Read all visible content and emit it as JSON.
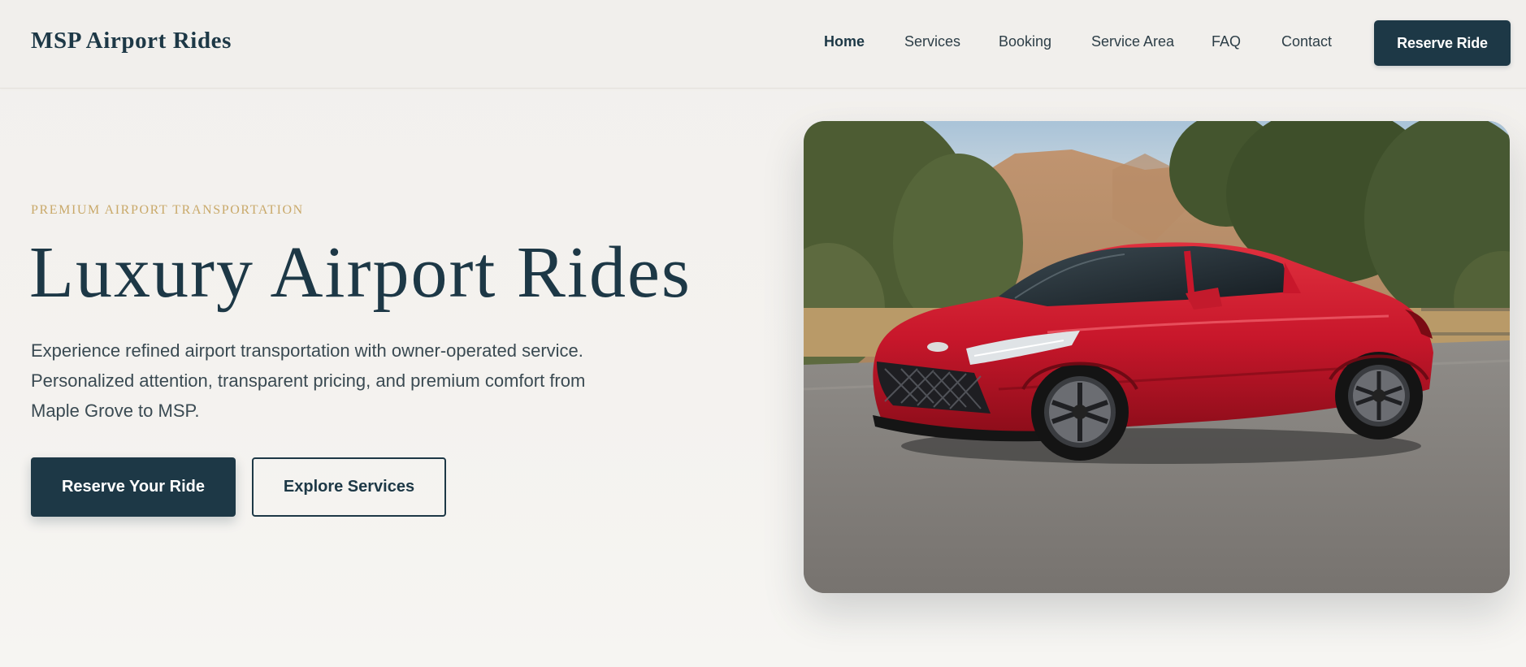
{
  "brand": {
    "name": "MSP Airport Rides"
  },
  "nav": {
    "links": [
      {
        "label": "Home"
      },
      {
        "label": "Services"
      },
      {
        "label": "Booking"
      },
      {
        "label": "Service Area"
      },
      {
        "label": "FAQ"
      },
      {
        "label": "Contact"
      }
    ],
    "active": "Home",
    "cta_label": "Reserve Ride"
  },
  "hero": {
    "eyebrow": "PREMIUM AIRPORT TRANSPORTATION",
    "title": "Luxury Airport Rides",
    "description": "Experience refined airport transportation with owner-operated service. Personalized attention, transparent pricing, and premium comfort from Maple Grove to MSP.",
    "primary_cta": "Reserve Your Ride",
    "secondary_cta": "Explore Services"
  },
  "colors": {
    "primary": "#1d3846",
    "accent_gold": "#c9a96a",
    "background": "#f3f1ee",
    "car_red": "#c8172b"
  }
}
